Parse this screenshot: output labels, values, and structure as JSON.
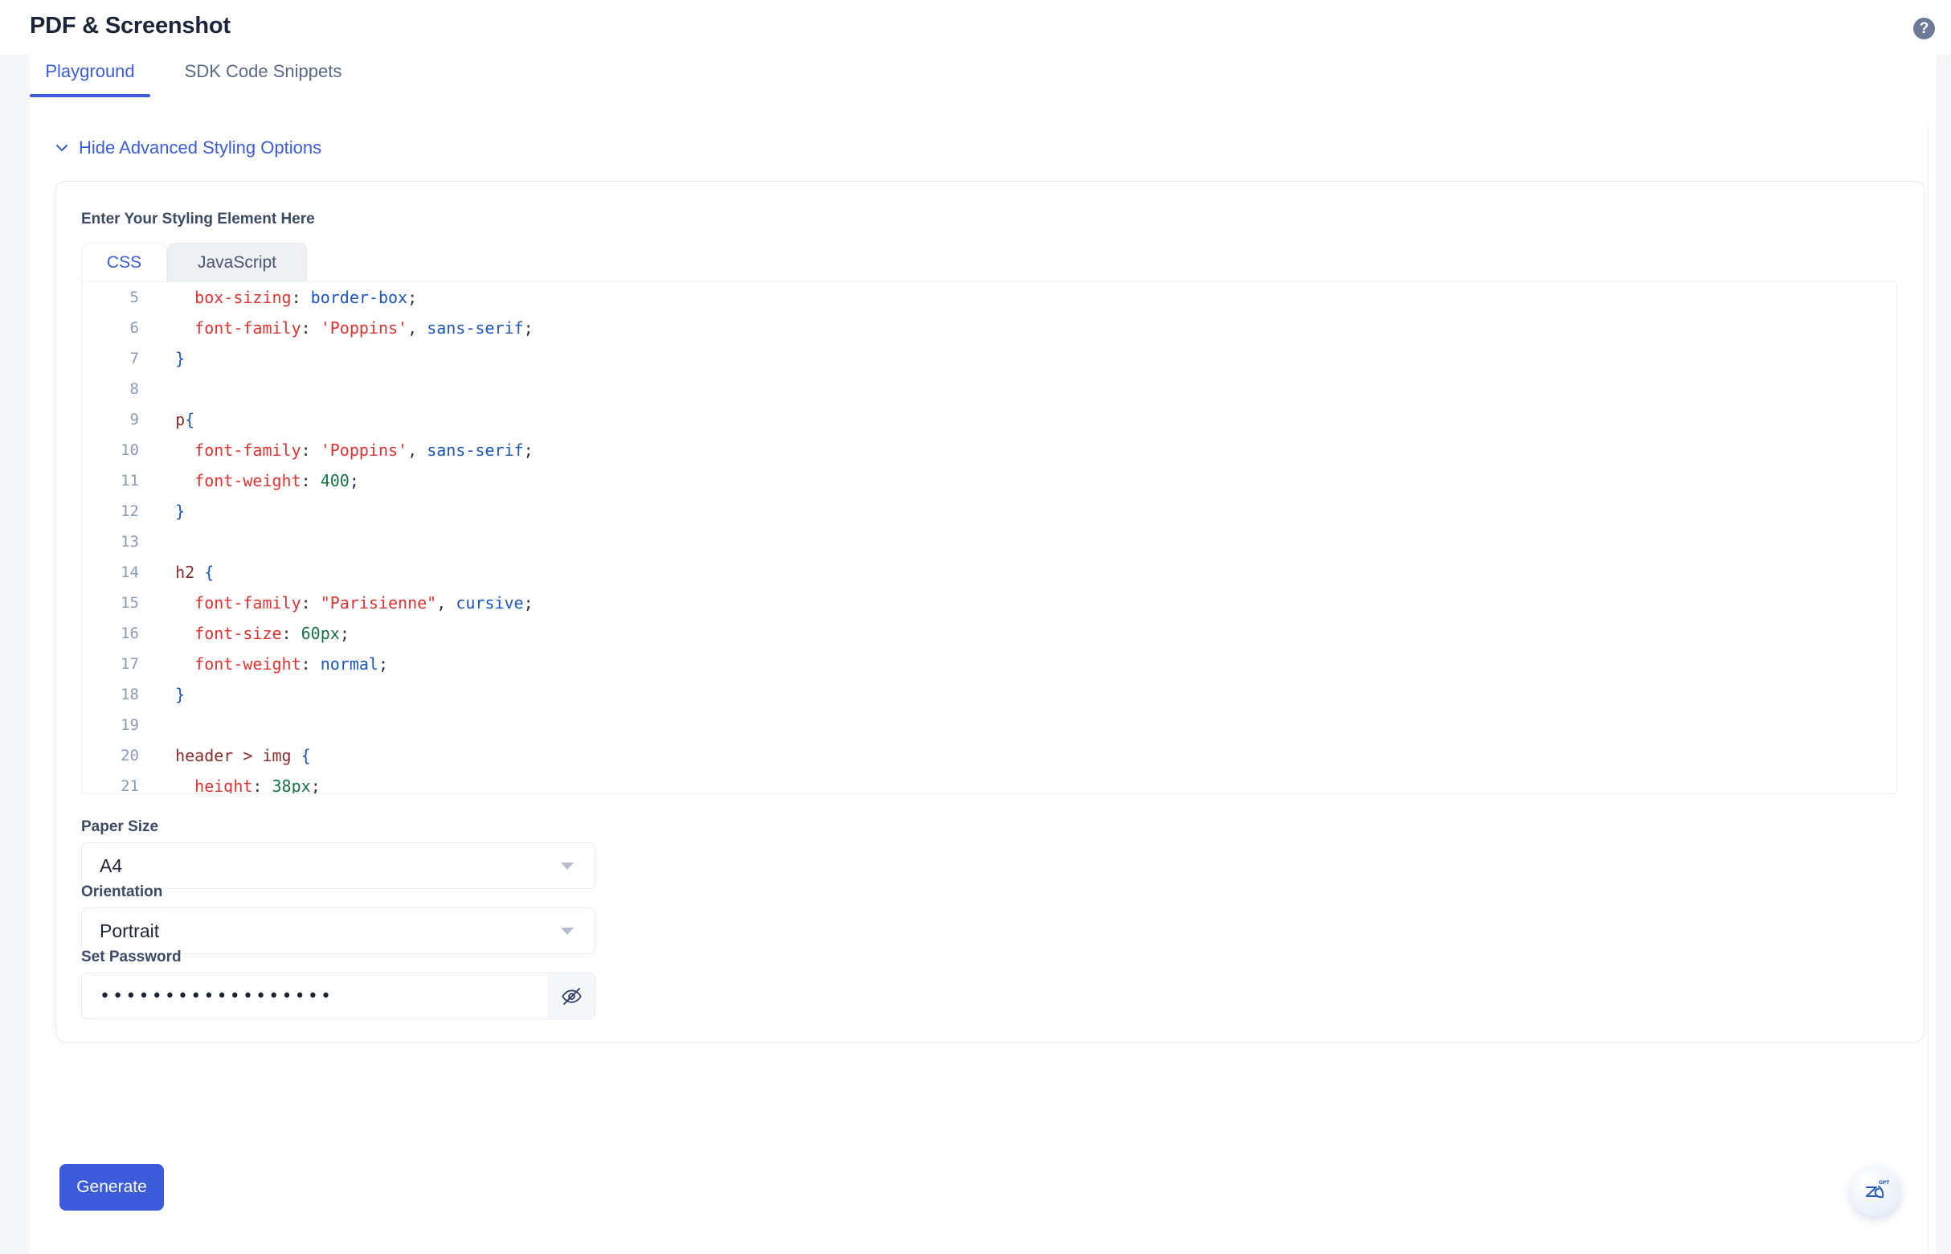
{
  "header": {
    "title": "PDF & Screenshot",
    "help_icon": "help-circle-icon",
    "help_label": "?"
  },
  "tabs": [
    {
      "label": "Playground",
      "active": true
    },
    {
      "label": "SDK Code Snippets",
      "active": false
    }
  ],
  "advanced": {
    "toggle_label": "Hide Advanced Styling Options",
    "chevron": "chevron-down-icon",
    "expanded": true
  },
  "styling_card": {
    "label": "Enter Your Styling Element Here",
    "editor_tabs": [
      {
        "label": "CSS",
        "active": true
      },
      {
        "label": "JavaScript",
        "active": false
      }
    ],
    "code_lines": [
      {
        "n": "5",
        "tokens": [
          {
            "t": "prop",
            "s": "    box-sizing"
          },
          {
            "t": "punct",
            "s": ": "
          },
          {
            "t": "val",
            "s": "border-box"
          },
          {
            "t": "punct",
            "s": ";"
          }
        ]
      },
      {
        "n": "6",
        "tokens": [
          {
            "t": "prop",
            "s": "    font-family"
          },
          {
            "t": "punct",
            "s": ": "
          },
          {
            "t": "prop",
            "s": "'Poppins'"
          },
          {
            "t": "punct",
            "s": ", "
          },
          {
            "t": "val",
            "s": "sans-serif"
          },
          {
            "t": "punct",
            "s": ";"
          }
        ]
      },
      {
        "n": "7",
        "tokens": [
          {
            "t": "brace",
            "s": "  }"
          }
        ]
      },
      {
        "n": "8",
        "tokens": []
      },
      {
        "n": "9",
        "tokens": [
          {
            "t": "sel",
            "s": "  p"
          },
          {
            "t": "brace",
            "s": "{"
          }
        ]
      },
      {
        "n": "10",
        "tokens": [
          {
            "t": "prop",
            "s": "    font-family"
          },
          {
            "t": "punct",
            "s": ": "
          },
          {
            "t": "prop",
            "s": "'Poppins'"
          },
          {
            "t": "punct",
            "s": ", "
          },
          {
            "t": "val",
            "s": "sans-serif"
          },
          {
            "t": "punct",
            "s": ";"
          }
        ]
      },
      {
        "n": "11",
        "tokens": [
          {
            "t": "prop",
            "s": "    font-weight"
          },
          {
            "t": "punct",
            "s": ": "
          },
          {
            "t": "num",
            "s": "400"
          },
          {
            "t": "punct",
            "s": ";"
          }
        ]
      },
      {
        "n": "12",
        "tokens": [
          {
            "t": "brace",
            "s": "  }"
          }
        ]
      },
      {
        "n": "13",
        "tokens": []
      },
      {
        "n": "14",
        "tokens": [
          {
            "t": "sel",
            "s": "  h2 "
          },
          {
            "t": "brace",
            "s": "{"
          }
        ]
      },
      {
        "n": "15",
        "tokens": [
          {
            "t": "prop",
            "s": "    font-family"
          },
          {
            "t": "punct",
            "s": ": "
          },
          {
            "t": "prop",
            "s": "\"Parisienne\""
          },
          {
            "t": "punct",
            "s": ", "
          },
          {
            "t": "val",
            "s": "cursive"
          },
          {
            "t": "punct",
            "s": ";"
          }
        ]
      },
      {
        "n": "16",
        "tokens": [
          {
            "t": "prop",
            "s": "    font-size"
          },
          {
            "t": "punct",
            "s": ": "
          },
          {
            "t": "num",
            "s": "60px"
          },
          {
            "t": "punct",
            "s": ";"
          }
        ]
      },
      {
        "n": "17",
        "tokens": [
          {
            "t": "prop",
            "s": "    font-weight"
          },
          {
            "t": "punct",
            "s": ": "
          },
          {
            "t": "val",
            "s": "normal"
          },
          {
            "t": "punct",
            "s": ";"
          }
        ]
      },
      {
        "n": "18",
        "tokens": [
          {
            "t": "brace",
            "s": "  }"
          }
        ]
      },
      {
        "n": "19",
        "tokens": []
      },
      {
        "n": "20",
        "tokens": [
          {
            "t": "sel",
            "s": "  header > img "
          },
          {
            "t": "brace",
            "s": "{"
          }
        ]
      },
      {
        "n": "21",
        "tokens": [
          {
            "t": "prop",
            "s": "    height"
          },
          {
            "t": "punct",
            "s": ": "
          },
          {
            "t": "num",
            "s": "38px"
          },
          {
            "t": "punct",
            "s": ";"
          }
        ]
      }
    ],
    "paper_size": {
      "label": "Paper Size",
      "value": "A4",
      "caret_icon": "caret-down-icon"
    },
    "orientation": {
      "label": "Orientation",
      "value": "Portrait",
      "caret_icon": "caret-down-icon"
    },
    "password": {
      "label": "Set Password",
      "value": "••••••••••••••••••",
      "placeholder": "Set Password",
      "toggle_icon": "eye-off-icon",
      "masked": true
    }
  },
  "actions": {
    "generate_label": "Generate"
  },
  "assistant": {
    "icon": "zia-gpt-assistant-icon",
    "badge": "GPT"
  },
  "colors": {
    "accent": "#3b5bdb",
    "title": "#1c2438",
    "label": "#3d4a66",
    "muted": "#5a6784",
    "rail": "#f5f7fb",
    "border": "#e8ebf2"
  }
}
